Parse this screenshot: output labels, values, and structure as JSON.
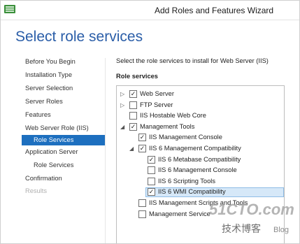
{
  "window": {
    "title": "Add Roles and Features Wizard"
  },
  "page": {
    "heading": "Select role services"
  },
  "nav": {
    "items": [
      {
        "label": "Before You Begin",
        "sub": false,
        "state": "normal"
      },
      {
        "label": "Installation Type",
        "sub": false,
        "state": "normal"
      },
      {
        "label": "Server Selection",
        "sub": false,
        "state": "normal"
      },
      {
        "label": "Server Roles",
        "sub": false,
        "state": "normal"
      },
      {
        "label": "Features",
        "sub": false,
        "state": "normal"
      },
      {
        "label": "Web Server Role (IIS)",
        "sub": false,
        "state": "normal"
      },
      {
        "label": "Role Services",
        "sub": true,
        "state": "selected"
      },
      {
        "label": "Application Server",
        "sub": false,
        "state": "normal"
      },
      {
        "label": "Role Services",
        "sub": true,
        "state": "normal"
      },
      {
        "label": "Confirmation",
        "sub": false,
        "state": "normal"
      },
      {
        "label": "Results",
        "sub": false,
        "state": "disabled"
      }
    ]
  },
  "main": {
    "instruction": "Select the role services to install for Web Server (IIS)",
    "section_label": "Role services",
    "tree": [
      {
        "label": "Web Server",
        "expander": "collapsed",
        "checked": true,
        "level": 0
      },
      {
        "label": "FTP Server",
        "expander": "collapsed",
        "checked": false,
        "level": 0
      },
      {
        "label": "IIS Hostable Web Core",
        "expander": "none",
        "checked": false,
        "level": 0
      },
      {
        "label": "Management Tools",
        "expander": "expanded",
        "checked": true,
        "level": 0
      },
      {
        "label": "IIS Management Console",
        "expander": "none",
        "checked": true,
        "level": 1
      },
      {
        "label": "IIS 6 Management Compatibility",
        "expander": "expanded",
        "checked": true,
        "level": 1
      },
      {
        "label": "IIS 6 Metabase Compatibility",
        "expander": "none",
        "checked": true,
        "level": 2
      },
      {
        "label": "IIS 6 Management Console",
        "expander": "none",
        "checked": false,
        "level": 2
      },
      {
        "label": "IIS 6 Scripting Tools",
        "expander": "none",
        "checked": false,
        "level": 2
      },
      {
        "label": "IIS 6 WMI Compatibility",
        "expander": "none",
        "checked": true,
        "level": 2,
        "highlighted": true
      },
      {
        "label": "IIS Management Scripts and Tools",
        "expander": "none",
        "checked": false,
        "level": 1
      },
      {
        "label": "Management Service",
        "expander": "none",
        "checked": false,
        "level": 1
      }
    ]
  },
  "watermark": {
    "site": "51CTO.com",
    "tagline": "技术博客",
    "blog": "Blog"
  },
  "colors": {
    "heading": "#2b5ea8",
    "selected_bg": "#1d6fbf",
    "highlight_bg": "#d6e8f8"
  },
  "icons": {
    "app": "server-manager-icon",
    "check": "✓",
    "collapsed": "▷",
    "expanded": "◢"
  }
}
